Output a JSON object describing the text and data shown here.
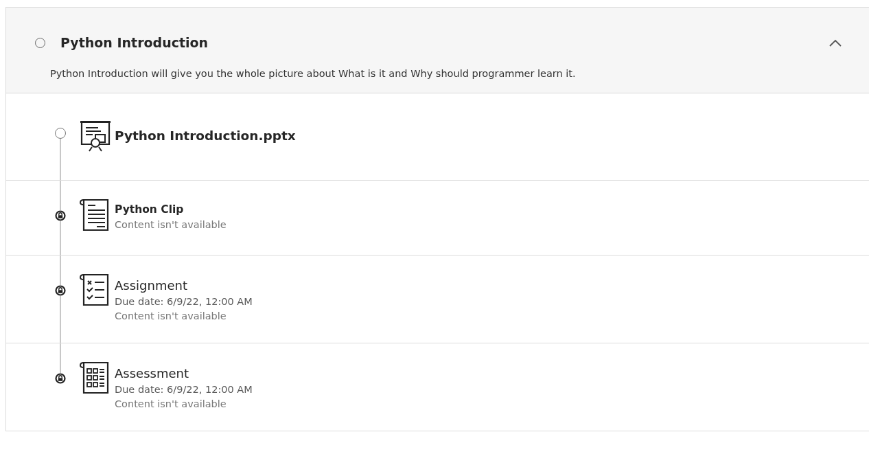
{
  "module": {
    "title": "Python Introduction",
    "completed": false,
    "expanded": true,
    "description": "Python Introduction will give you the whole picture about What is it and Why should programmer learn it."
  },
  "items": [
    {
      "kind": "presentation",
      "title": "Python Introduction.pptx",
      "locked": false
    },
    {
      "kind": "document",
      "title": "Python Clip",
      "status": "Content isn't available",
      "locked": true
    },
    {
      "kind": "assignment",
      "title": "Assignment",
      "due_date": "Due date: 6/9/22, 12:00 AM",
      "status": "Content isn't available",
      "locked": true
    },
    {
      "kind": "assessment",
      "title": "Assessment",
      "due_date": "Due date: 6/9/22, 12:00 AM",
      "status": "Content isn't available",
      "locked": true
    }
  ]
}
